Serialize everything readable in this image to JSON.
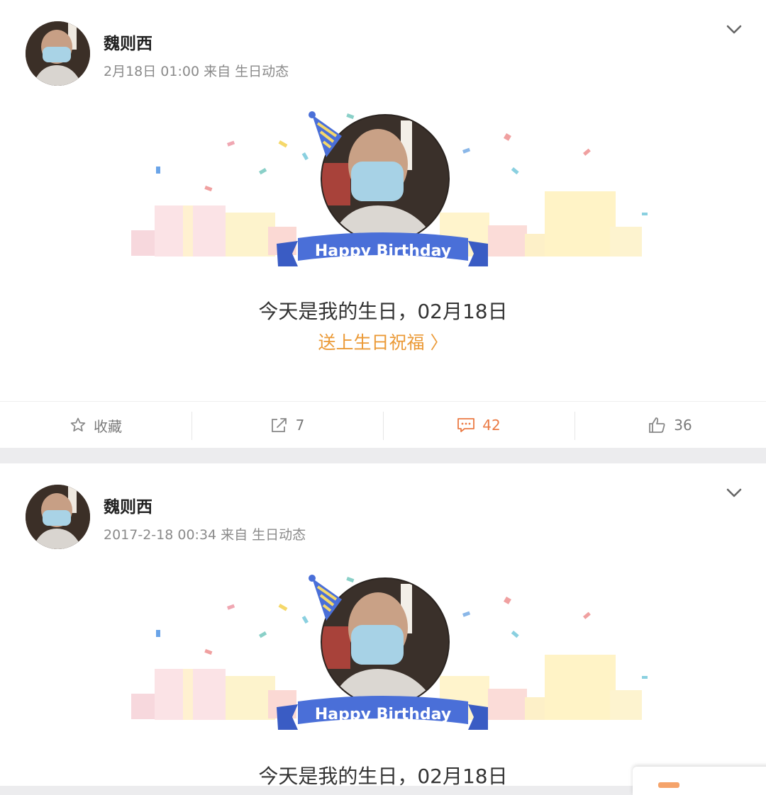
{
  "posts": [
    {
      "author": "魏则西",
      "time": "2月18日 01:00",
      "source": "来自 生日动态",
      "banner_text": "Happy Birthday",
      "message": "今天是我的生日，02月18日",
      "link_label": "送上生日祝福 〉",
      "actions": {
        "favorite_label": "收藏",
        "repost_count": "7",
        "comment_count": "42",
        "like_count": "36"
      }
    },
    {
      "author": "魏则西",
      "time": "2017-2-18 00:34",
      "source": "来自 生日动态",
      "banner_text": "Happy Birthday",
      "message": "今天是我的生日，02月18日"
    }
  ],
  "colors": {
    "link": "#eb9a37",
    "comment_active": "#eb7a44",
    "banner_blue": "#4a6fd8",
    "page_gap": "#ececee"
  },
  "icons": [
    "chevron-down-icon",
    "star-icon",
    "share-icon",
    "comment-icon",
    "thumbs-up-icon"
  ]
}
